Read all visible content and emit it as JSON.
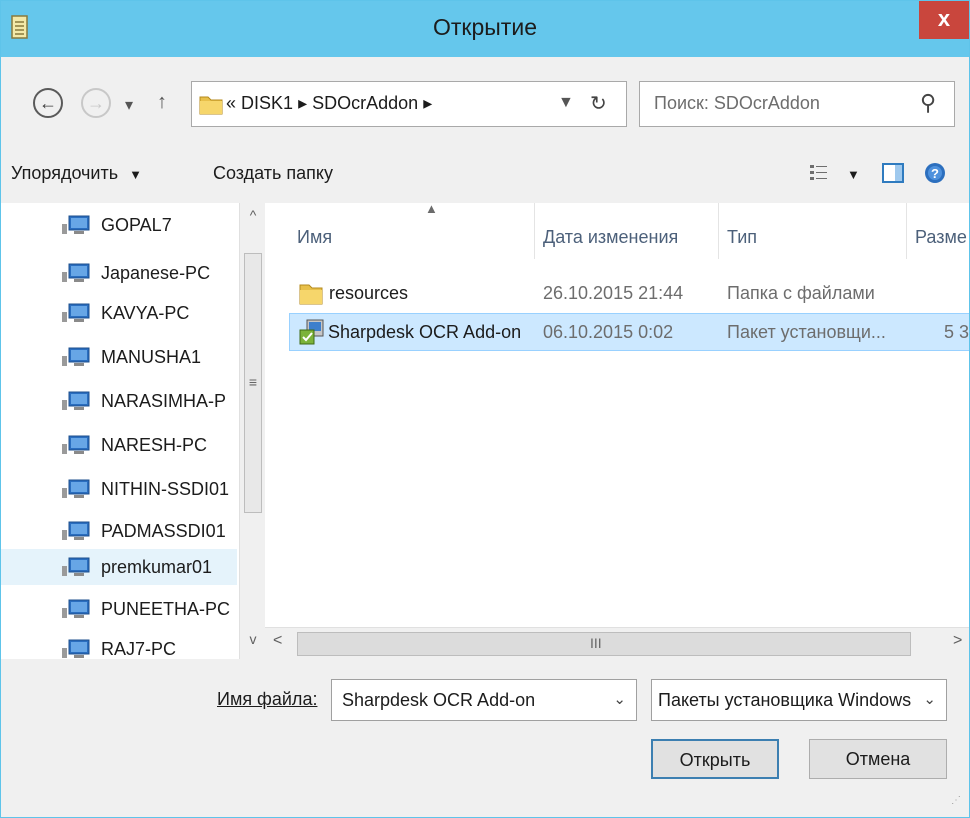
{
  "window": {
    "title": "Открытие",
    "close_label": "x"
  },
  "nav": {
    "back": "←",
    "forward": "→",
    "recent_dropdown": "▾",
    "up": "↑",
    "address": {
      "prefix": "«",
      "segments": [
        "DISK1",
        "SDOcrAddon"
      ],
      "separator": "▸"
    },
    "refresh": "↻",
    "search_placeholder": "Поиск: SDOcrAddon",
    "search_icon": "⚲"
  },
  "toolbar": {
    "organize_label": "Упорядочить",
    "organize_arrow": "▼",
    "new_folder_label": "Создать папку",
    "view_arrow": "▼"
  },
  "tree": {
    "items": [
      {
        "label": "GOPAL7"
      },
      {
        "label": "Japanese-PC"
      },
      {
        "label": "KAVYA-PC"
      },
      {
        "label": "MANUSHA1"
      },
      {
        "label": "NARASIMHA-P"
      },
      {
        "label": "NARESH-PC"
      },
      {
        "label": "NITHIN-SSDI01"
      },
      {
        "label": "PADMASSDI01"
      },
      {
        "label": "premkumar01",
        "selected": true
      },
      {
        "label": "PUNEETHA-PC"
      },
      {
        "label": "RAJ7-PC"
      }
    ],
    "scroll_up": "^",
    "scroll_down": "v",
    "scroll_grip": "≡"
  },
  "filelist": {
    "columns": [
      "Имя",
      "Дата изменения",
      "Тип",
      "Разме"
    ],
    "rows": [
      {
        "name": "resources",
        "date": "26.10.2015 21:44",
        "type": "Папка с файлами",
        "size": "",
        "icon": "folder-icon",
        "selected": false
      },
      {
        "name": "Sharpdesk OCR Add-on",
        "date": "06.10.2015 0:02",
        "type": "Пакет установщи...",
        "size": "5 3",
        "icon": "installer-package-icon",
        "selected": true
      }
    ],
    "scroll_left": "<",
    "scroll_right": ">",
    "scroll_grip": "III"
  },
  "bottom": {
    "filename_label": "Имя файла:",
    "filename_value": "Sharpdesk OCR Add-on",
    "filetype_value": "Пакеты установщика Windows",
    "combo_arrow": "⌄",
    "open_label": "Открыть",
    "cancel_label": "Отмена"
  },
  "colors": {
    "titlebar": "#65c7ec",
    "close_button": "#c9463d",
    "selection": "#cce8ff"
  }
}
